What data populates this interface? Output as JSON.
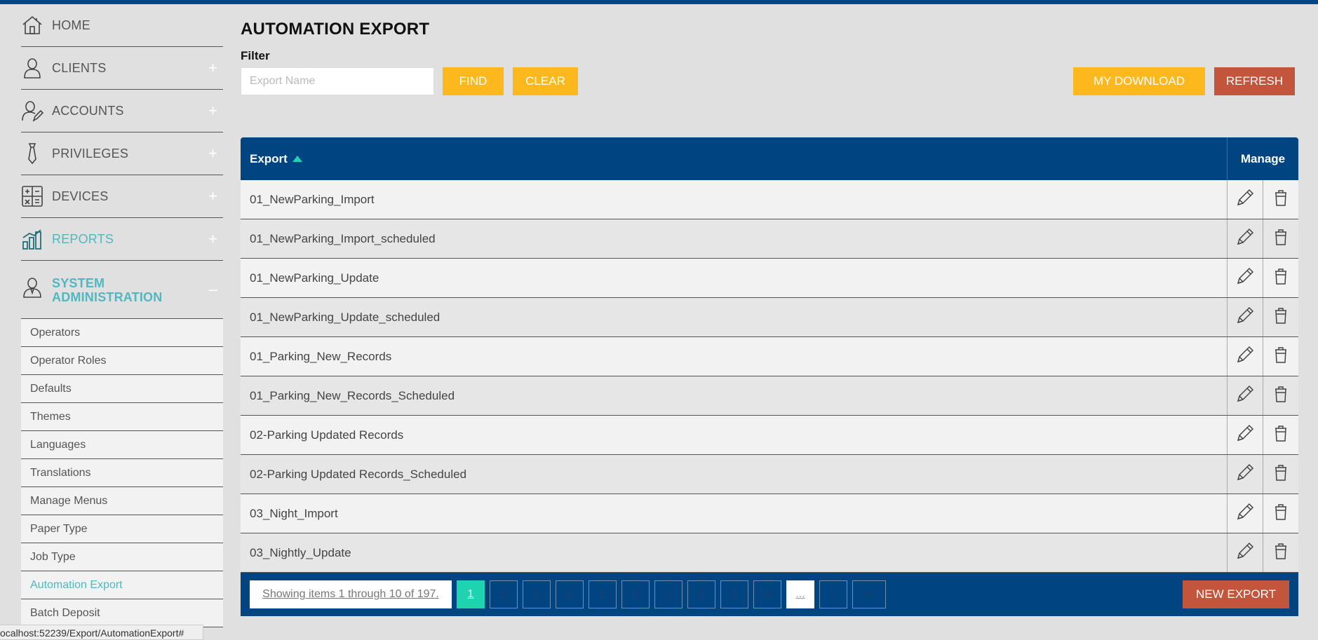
{
  "sidebar": {
    "items": [
      {
        "label": "HOME",
        "icon": "home-icon",
        "toggle": ""
      },
      {
        "label": "CLIENTS",
        "icon": "user-icon",
        "toggle": "+"
      },
      {
        "label": "ACCOUNTS",
        "icon": "user-edit-icon",
        "toggle": "+"
      },
      {
        "label": "PRIVILEGES",
        "icon": "tie-icon",
        "toggle": "+"
      },
      {
        "label": "DEVICES",
        "icon": "calculator-icon",
        "toggle": "+"
      },
      {
        "label": "REPORTS",
        "icon": "bar-chart-icon",
        "toggle": "+"
      },
      {
        "label": "SYSTEM ADMINISTRATION",
        "icon": "admin-user-icon",
        "toggle": "–"
      }
    ],
    "sub_items": [
      {
        "label": "Operators"
      },
      {
        "label": "Operator Roles"
      },
      {
        "label": "Defaults"
      },
      {
        "label": "Themes"
      },
      {
        "label": "Languages"
      },
      {
        "label": "Translations"
      },
      {
        "label": "Manage Menus"
      },
      {
        "label": "Paper Type"
      },
      {
        "label": "Job Type"
      },
      {
        "label": "Automation Export"
      },
      {
        "label": "Batch Deposit"
      }
    ],
    "active_sub_item": "Automation Export"
  },
  "status_url": "ocalhost:52239/Export/AutomationExport#",
  "page": {
    "title": "AUTOMATION EXPORT",
    "filter_label": "Filter",
    "filter_placeholder": "Export Name",
    "filter_value": "",
    "find_label": "FIND",
    "clear_label": "CLEAR",
    "my_download_label": "MY DOWNLOAD",
    "refresh_label": "REFRESH"
  },
  "table": {
    "col_export": "Export",
    "col_manage": "Manage",
    "rows": [
      {
        "name": "01_NewParking_Import"
      },
      {
        "name": "01_NewParking_Import_scheduled"
      },
      {
        "name": "01_NewParking_Update"
      },
      {
        "name": "01_NewParking_Update_scheduled"
      },
      {
        "name": "01_Parking_New_Records"
      },
      {
        "name": "01_Parking_New_Records_Scheduled"
      },
      {
        "name": "02-Parking Updated Records"
      },
      {
        "name": "02-Parking Updated Records_Scheduled"
      },
      {
        "name": "03_Night_Import"
      },
      {
        "name": "03_Nightly_Update"
      }
    ]
  },
  "pager": {
    "info": "Showing items 1 through 10 of 197.",
    "pages": [
      "1",
      "2",
      "3",
      "4",
      "5",
      "6",
      "7",
      "8",
      "9",
      "10"
    ],
    "current_page": "1",
    "ellipsis": "...",
    "next": ">",
    "last": ">>",
    "new_export_label": "NEW EXPORT"
  },
  "colors": {
    "header_blue": "#004481",
    "accent_teal": "#1dd3b0",
    "active_text": "#4fb8c0",
    "button_yellow": "#fdb81e",
    "button_red": "#c2553c"
  }
}
